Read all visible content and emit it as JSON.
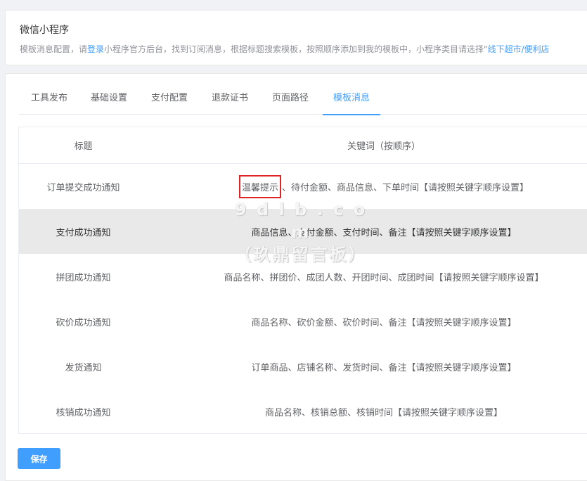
{
  "header": {
    "title": "微信小程序",
    "desc_prefix": "模板消息配置，请",
    "desc_link": "登录",
    "desc_suffix": "小程序官方后台，找到订阅消息，根据标题搜索模板，按照顺序添加到我的模板中，小程序类目请选择\"",
    "desc_link2": "线下超市/便利店"
  },
  "tabs": [
    {
      "label": "工具发布",
      "active": false
    },
    {
      "label": "基础设置",
      "active": false
    },
    {
      "label": "支付配置",
      "active": false
    },
    {
      "label": "退款证书",
      "active": false
    },
    {
      "label": "页面路径",
      "active": false
    },
    {
      "label": "模板消息",
      "active": true
    }
  ],
  "table": {
    "headers": {
      "title": "标题",
      "keywords": "关键词（按顺序）"
    },
    "first_row_marked_keyword": "温馨提示",
    "first_row_keyword_rest": "、待付金额、商品信息、下单时间【请按照关键字顺序设置】",
    "rows": [
      {
        "title": "订单提交成功通知",
        "keywords": "温馨提示、待付金额、商品信息、下单时间【请按照关键字顺序设置】"
      },
      {
        "title": "支付成功通知",
        "keywords": "商品信息、支付金额、支付时间、备注【请按照关键字顺序设置】"
      },
      {
        "title": "拼团成功通知",
        "keywords": "商品名称、拼团价、成团人数、开团时间、成团时间【请按照关键字顺序设置】"
      },
      {
        "title": "砍价成功通知",
        "keywords": "商品名称、砍价金额、砍价时间、备注【请按照关键字顺序设置】"
      },
      {
        "title": "发货通知",
        "keywords": "订单商品、店铺名称、发货时间、备注【请按照关键字顺序设置】"
      },
      {
        "title": "核销成功通知",
        "keywords": "商品名称、核销总额、核销时间【请按照关键字顺序设置】"
      }
    ]
  },
  "save_label": "保存",
  "watermark": {
    "line1": "9 d l b . c o m",
    "line2": "（玖鼎留言板）"
  },
  "colors": {
    "accent": "#409eff",
    "highlight_row": "#e9e9e9",
    "mark_border": "#e02424"
  }
}
